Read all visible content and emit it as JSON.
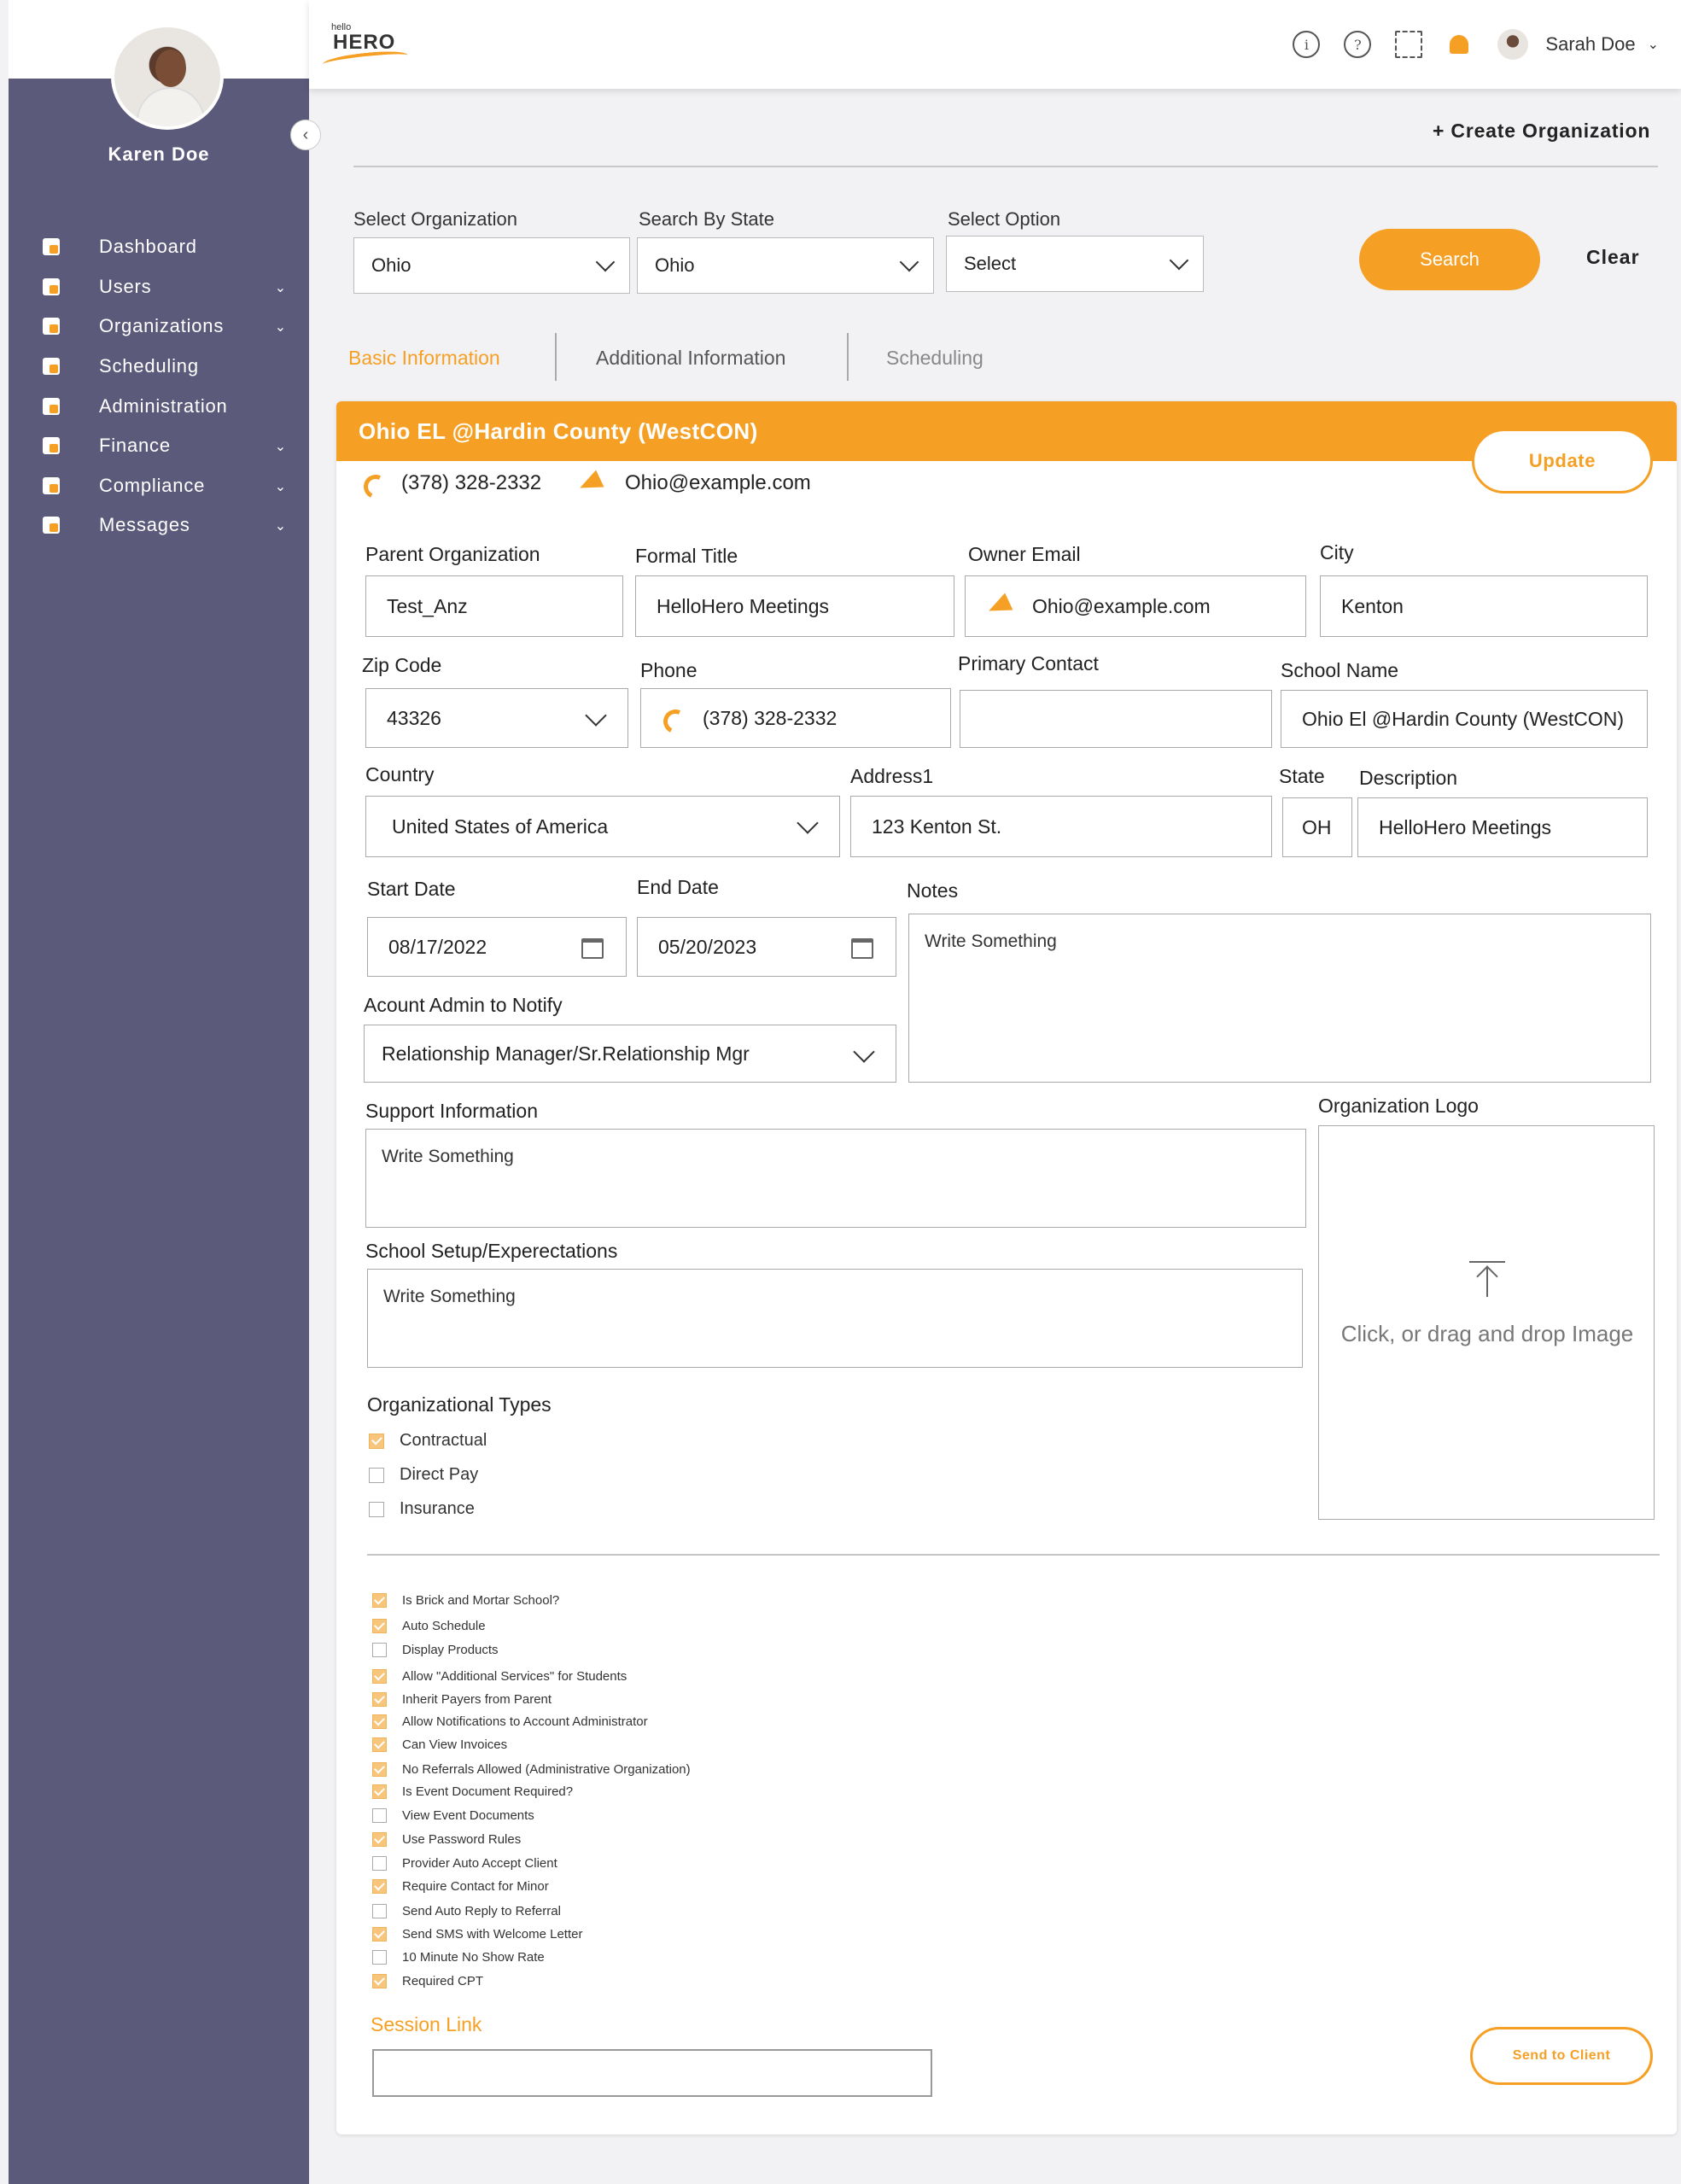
{
  "sidebar": {
    "user_name": "Karen Doe",
    "items": [
      {
        "label": "Dashboard",
        "icon": "dashboard-icon",
        "has_children": false
      },
      {
        "label": "Users",
        "icon": "users-icon",
        "has_children": true
      },
      {
        "label": "Organizations",
        "icon": "organizations-icon",
        "has_children": true
      },
      {
        "label": "Scheduling",
        "icon": "calendar-icon",
        "has_children": false
      },
      {
        "label": "Administration",
        "icon": "admin-icon",
        "has_children": false
      },
      {
        "label": "Finance",
        "icon": "finance-icon",
        "has_children": true
      },
      {
        "label": "Compliance",
        "icon": "compliance-icon",
        "has_children": true
      },
      {
        "label": "Messages",
        "icon": "messages-icon",
        "has_children": true
      }
    ]
  },
  "header": {
    "logo_small": "hello",
    "logo_big": "HERO",
    "user_name": "Sarah Doe"
  },
  "toolbar": {
    "create_label": "+ Create Organization"
  },
  "filters": {
    "org_label": "Select Organization",
    "org_value": "Ohio",
    "state_label": "Search By State",
    "state_value": "Ohio",
    "option_label": "Select Option",
    "option_value": "Select",
    "search_label": "Search",
    "clear_label": "Clear"
  },
  "tabs": [
    {
      "label": "Basic Information",
      "active": true
    },
    {
      "label": "Additional Information",
      "active": false
    },
    {
      "label": "Scheduling",
      "active": false
    }
  ],
  "card": {
    "title": "Ohio EL @Hardin County (WestCON)",
    "update_label": "Update",
    "phone": "(378) 328-2332",
    "email": "Ohio@example.com"
  },
  "form": {
    "parent_org": {
      "label": "Parent Organization",
      "value": "Test_Anz"
    },
    "formal_title": {
      "label": "Formal Title",
      "value": "HelloHero Meetings"
    },
    "owner_email": {
      "label": "Owner Email",
      "value": "Ohio@example.com"
    },
    "city": {
      "label": "City",
      "value": "Kenton"
    },
    "zip": {
      "label": "Zip Code",
      "value": "43326"
    },
    "phone": {
      "label": "Phone",
      "value": "(378) 328-2332"
    },
    "primary_contact": {
      "label": "Primary Contact",
      "value": ""
    },
    "school_name": {
      "label": "School Name",
      "value": "Ohio El @Hardin County (WestCON)"
    },
    "country": {
      "label": "Country",
      "value": "United States of America"
    },
    "address1": {
      "label": "Address1",
      "value": "123 Kenton St."
    },
    "state": {
      "label": "State",
      "value": "OH"
    },
    "description": {
      "label": "Description",
      "value": "HelloHero Meetings"
    },
    "start_date": {
      "label": "Start Date",
      "value": "08/17/2022"
    },
    "end_date": {
      "label": "End Date",
      "value": "05/20/2023"
    },
    "notes": {
      "label": "Notes",
      "value": "Write Something"
    },
    "account_admin": {
      "label": "Acount Admin to Notify",
      "value": "Relationship Manager/Sr.Relationship Mgr"
    },
    "support_info": {
      "label": "Support Information",
      "value": "Write Something"
    },
    "school_setup": {
      "label": "School Setup/Experectations",
      "value": "Write Something"
    },
    "org_logo": {
      "label": "Organization Logo",
      "upload_text": "Click, or drag and drop Image"
    },
    "org_types_label": "Organizational Types",
    "org_types": [
      {
        "label": "Contractual",
        "checked": true
      },
      {
        "label": "Direct Pay",
        "checked": false
      },
      {
        "label": "Insurance",
        "checked": false
      }
    ],
    "options": [
      {
        "label": "Is Brick and Mortar School?",
        "checked": true
      },
      {
        "label": "Auto Schedule",
        "checked": true
      },
      {
        "label": "Display Products",
        "checked": false
      },
      {
        "label": "Allow \"Additional Services\" for Students",
        "checked": true
      },
      {
        "label": "Inherit Payers from Parent",
        "checked": true
      },
      {
        "label": "Allow Notifications to Account Administrator",
        "checked": true
      },
      {
        "label": "Can View Invoices",
        "checked": true
      },
      {
        "label": "No Referrals Allowed (Administrative Organization)",
        "checked": true
      },
      {
        "label": "Is Event Document Required?",
        "checked": true
      },
      {
        "label": "View Event Documents",
        "checked": false
      },
      {
        "label": "Use Password Rules",
        "checked": true
      },
      {
        "label": "Provider Auto Accept Client",
        "checked": false
      },
      {
        "label": "Require Contact for Minor",
        "checked": true
      },
      {
        "label": "Send Auto Reply to Referral",
        "checked": false
      },
      {
        "label": "Send SMS with Welcome Letter",
        "checked": true
      },
      {
        "label": "10 Minute No Show Rate",
        "checked": false
      },
      {
        "label": "Required CPT",
        "checked": true
      }
    ],
    "session_link_label": "Session Link",
    "session_link_value": "",
    "send_client_label": "Send to Client"
  },
  "colors": {
    "accent": "#f5a024",
    "sidebar": "#5c5a7a"
  }
}
